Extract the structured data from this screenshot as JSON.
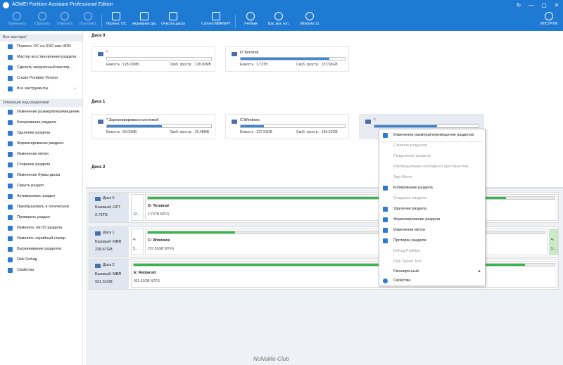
{
  "window": {
    "title": "AOMEI Partition Assistant Professional Edition",
    "controls": [
      "↻",
      "—",
      "▢",
      "✕"
    ]
  },
  "toolbar": {
    "items": [
      {
        "label": "Применить",
        "icon": "check-icon",
        "enabled": false
      },
      {
        "label": "Сбросить",
        "icon": "discard-icon",
        "enabled": false
      },
      {
        "label": "Отменить",
        "icon": "undo-icon",
        "enabled": false
      },
      {
        "label": "Повторить",
        "icon": "redo-icon",
        "enabled": false
      },
      {
        "label": "Перенос ОС",
        "icon": "migrate-os-icon",
        "enabled": true
      },
      {
        "label": "нирование дис",
        "icon": "clone-disk-icon",
        "enabled": true
      },
      {
        "label": "Очистка диска",
        "icon": "wipe-disk-icon",
        "enabled": true
      },
      {
        "label": "Convert MBR/GPT",
        "icon": "convert-icon",
        "enabled": true
      },
      {
        "label": "Учебник",
        "icon": "tutorial-icon",
        "enabled": true
      },
      {
        "label": "Бэк. рез. коп.",
        "icon": "backup-icon",
        "enabled": true
      },
      {
        "label": "Windows 11",
        "icon": "windows-icon",
        "enabled": true
      },
      {
        "label": "ИНСТРУМ",
        "icon": "tools-icon",
        "enabled": true
      }
    ]
  },
  "sidebar": {
    "wizards_title": "Все мастера!",
    "wizards": [
      {
        "label": "Перенос ОС на SSD или HDD",
        "icon": "migrate-icon"
      },
      {
        "label": "Мастер восстановления раздела",
        "icon": "recovery-icon"
      },
      {
        "label": "Сделать загрузочный мастер...",
        "icon": "bootable-icon"
      },
      {
        "label": "Create Portable Version",
        "icon": "portable-icon"
      },
      {
        "label": "Все инструменты",
        "icon": "tools-icon"
      }
    ],
    "ops_title": "Операции над разделами",
    "operations": [
      {
        "label": "Изменение размера/перемещение",
        "icon": "resize-icon"
      },
      {
        "label": "Копирование раздела",
        "icon": "copy-icon"
      },
      {
        "label": "Удаление раздела",
        "icon": "delete-icon"
      },
      {
        "label": "Форматирование раздела",
        "icon": "format-icon"
      },
      {
        "label": "Изменение метки",
        "icon": "label-icon"
      },
      {
        "label": "Стирание раздела",
        "icon": "wipe-icon"
      },
      {
        "label": "Изменение буквы диска",
        "icon": "drive-letter-icon"
      },
      {
        "label": "Скрыть раздел",
        "icon": "hide-icon"
      },
      {
        "label": "Активировать раздел",
        "icon": "activate-icon"
      },
      {
        "label": "Преобразовать в логический",
        "icon": "convert-logical-icon"
      },
      {
        "label": "Проверить раздел",
        "icon": "check-partition-icon"
      },
      {
        "label": "Изменить тип ID раздела",
        "icon": "type-id-icon"
      },
      {
        "label": "Изменить серийный номер",
        "icon": "serial-icon"
      },
      {
        "label": "Выравнивание разделов",
        "icon": "align-icon"
      },
      {
        "label": "Disk Defrag",
        "icon": "defrag-icon"
      },
      {
        "label": "Свойства",
        "icon": "info-icon"
      }
    ]
  },
  "cards": {
    "disk0_label": "Диск 0",
    "disk1_label": "Диск 1",
    "disk2_label": "Диск 2",
    "d0p1": {
      "name": "*:",
      "capacity": "Емкость : 128.00MB",
      "free": "Своб. простр. : 128.00MB",
      "fill": 0.0
    },
    "d0p2": {
      "name": "D:Terminal",
      "capacity": "Емкость : 2.73TB",
      "free": "Своб. простр. : 373.58GB",
      "fill": 0.85
    },
    "d1p1": {
      "name": "*:Зарезервировано системой",
      "capacity": "Емкость : 50.00MB",
      "free": "Своб. простр. : 23.48MB",
      "fill": 0.53
    },
    "d1p2": {
      "name": "C:Windows",
      "capacity": "Емкость : 237.91GB",
      "free": "Своб. простр. : 185.22GB",
      "fill": 0.22
    },
    "d1p3": {
      "name": "*:",
      "fill": 0.6
    }
  },
  "disks": [
    {
      "name": "Диск 0",
      "type": "Базовый: GPT",
      "size": "2.73TB",
      "small_info": "12...",
      "part_name": "D: Terminal",
      "part_info": "2.73TB NTFS",
      "fill": 0.88
    },
    {
      "name": "Диск 1",
      "type": "Базовый: MBR",
      "size": "238.47GB",
      "small_name": "*:",
      "small_info": "5...",
      "part_name": "C: Windows",
      "part_info": "237.91GB NTFS",
      "fill": 0.22,
      "tail_name": "*:",
      "tail_info": "5..."
    },
    {
      "name": "Диск 2",
      "type": "Базовый: MBR",
      "size": "931.51GB",
      "part_name": "E: Replaced",
      "part_info": "931.51GB NTFS",
      "fill": 0.93
    }
  ],
  "context_menu": [
    {
      "label": "Изменение размера/перемещение разделов",
      "icon": "resize-icon",
      "enabled": true
    },
    {
      "label": "Слияние разделов",
      "enabled": false
    },
    {
      "label": "Разделение раздела",
      "enabled": false
    },
    {
      "label": "Распределение свободного пространства",
      "enabled": false
    },
    {
      "label": "App Mover",
      "enabled": false
    },
    {
      "label": "Копирование раздела",
      "icon": "copy-icon",
      "enabled": true
    },
    {
      "label": "Создание раздела",
      "enabled": false
    },
    {
      "label": "Удаление раздела",
      "icon": "delete-icon",
      "enabled": true
    },
    {
      "label": "Форматирование раздела",
      "icon": "format-icon",
      "enabled": true
    },
    {
      "label": "Изменение метки",
      "icon": "label-icon",
      "enabled": true
    },
    {
      "label": "Протирка раздела",
      "icon": "wipe-icon",
      "enabled": true
    },
    {
      "label": "Defrag Partition",
      "enabled": false
    },
    {
      "label": "Disk Speed Test",
      "enabled": false
    },
    {
      "label": "Расширенный",
      "enabled": true,
      "submenu": true
    },
    {
      "label": "Свойства",
      "icon": "info-icon",
      "enabled": true
    }
  ],
  "watermark": "NoNaMe-Club",
  "colors": {
    "accent": "#1f7ad4",
    "bar_blue": "#3b86d8",
    "bar_green": "#33b84d"
  }
}
